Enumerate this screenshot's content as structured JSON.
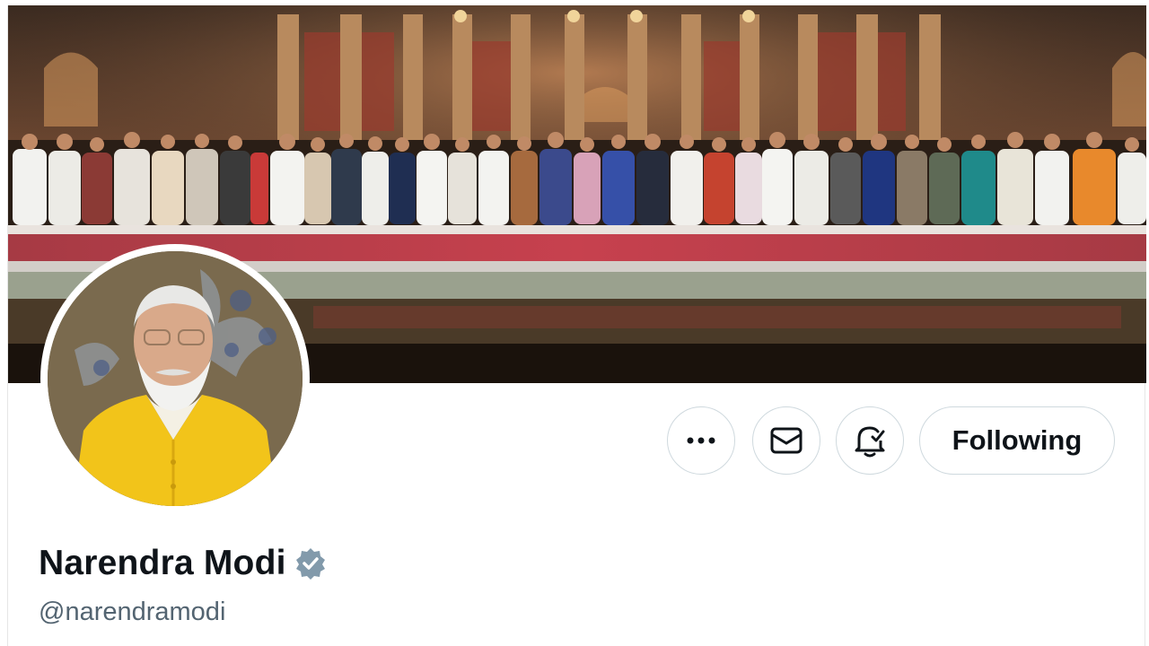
{
  "profile": {
    "display_name": "Narendra Modi",
    "handle": "@narendramodi",
    "verified": true,
    "verified_badge_color": "#829aab"
  },
  "actions": {
    "more_icon": "ellipsis-icon",
    "message_icon": "envelope-icon",
    "notify_icon": "bell-check-icon",
    "follow_label": "Following"
  },
  "colors": {
    "text_primary": "#0f1419",
    "text_secondary": "#536471",
    "button_border": "#cfd9de"
  }
}
